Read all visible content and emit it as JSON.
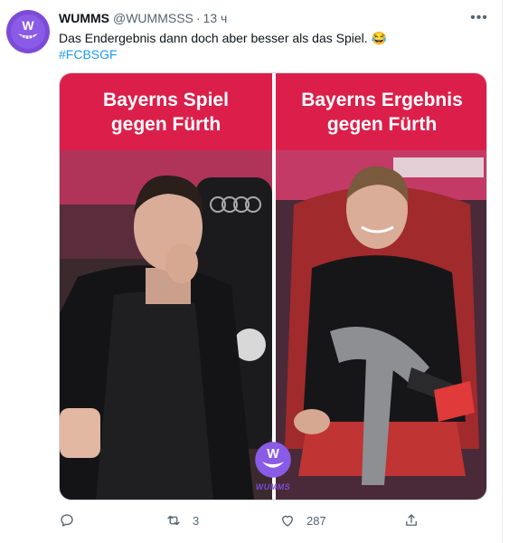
{
  "tweet": {
    "author_name": "WUMMS",
    "handle": "@WUMMSSS",
    "separator": "·",
    "time": "13 ч",
    "text": "Das Endergebnis dann doch aber besser als das Spiel. 😂",
    "hashtag": "#FCBSGF",
    "more_label": "•••"
  },
  "media": {
    "left_caption_line1": "Bayerns Spiel",
    "left_caption_line2": "gegen Fürth",
    "right_caption_line1": "Bayerns Ergebnis",
    "right_caption_line2": "gegen Fürth",
    "watermark_text": "WUMMS",
    "caption_color": "#dc1f4a"
  },
  "actions": {
    "reply_count": "",
    "retweet_count": "3",
    "like_count": "287",
    "icons": [
      "reply-icon",
      "retweet-icon",
      "like-icon",
      "share-icon"
    ]
  },
  "colors": {
    "link": "#1d9bf0",
    "muted": "#536471",
    "brand_purple": "#7c4bd8"
  }
}
